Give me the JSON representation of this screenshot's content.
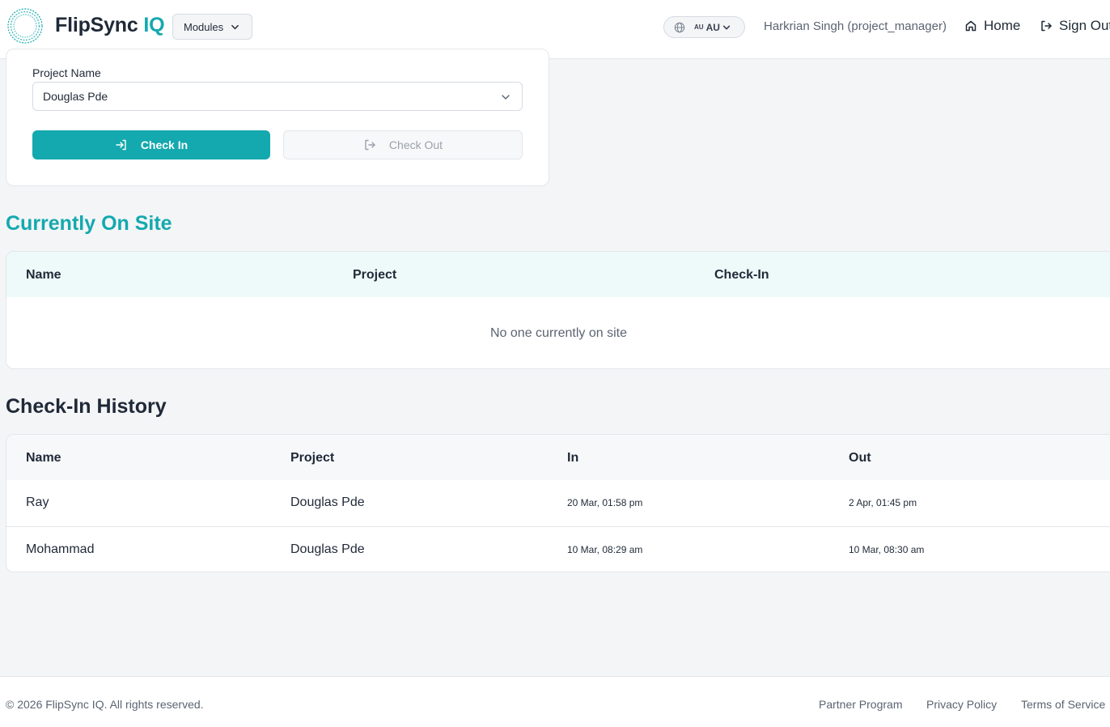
{
  "header": {
    "brand_main": "FlipSync",
    "brand_accent": "IQ",
    "modules_label": "Modules",
    "locale_flag": "AU",
    "locale_code": "AU",
    "user": "Harkrian Singh (project_manager)",
    "home_label": "Home",
    "signout_label": "Sign Out"
  },
  "checkin_form": {
    "project_label": "Project Name",
    "project_value": "Douglas Pde",
    "checkin_label": "Check In",
    "checkout_label": "Check Out"
  },
  "onsite": {
    "title": "Currently On Site",
    "columns": [
      "Name",
      "Project",
      "Check-In"
    ],
    "empty_message": "No one currently on site"
  },
  "history": {
    "title": "Check-In History",
    "columns": [
      "Name",
      "Project",
      "In",
      "Out"
    ],
    "rows": [
      {
        "name": "Ray",
        "project": "Douglas Pde",
        "in": "20 Mar, 01:58 pm",
        "out": "2 Apr, 01:45 pm"
      },
      {
        "name": "Mohammad",
        "project": "Douglas Pde",
        "in": "10 Mar, 08:29 am",
        "out": "10 Mar, 08:30 am"
      }
    ]
  },
  "footer": {
    "copyright": "© 2026 FlipSync IQ. All rights reserved.",
    "links": [
      "Partner Program",
      "Privacy Policy",
      "Terms of Service"
    ]
  },
  "colors": {
    "accent": "#14a9ae",
    "text": "#1f2937",
    "muted": "#5b6472"
  }
}
